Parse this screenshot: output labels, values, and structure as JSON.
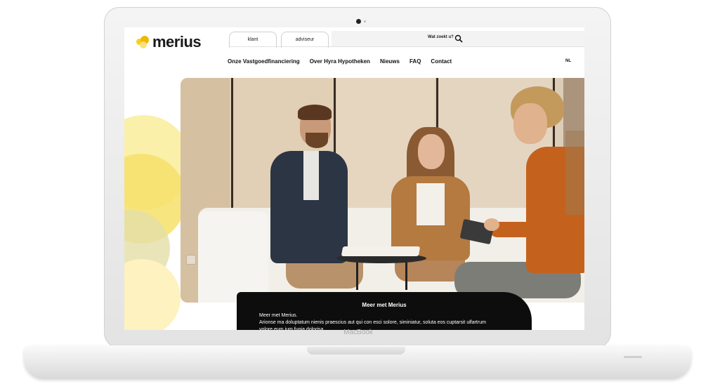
{
  "device": {
    "bottom_label": "MacBook"
  },
  "brand": {
    "name": "merius"
  },
  "tabs": [
    {
      "label": "klant"
    },
    {
      "label": "adviseur"
    }
  ],
  "search": {
    "label": "Wat zoekt u?",
    "icon": "search-icon"
  },
  "nav": {
    "items": [
      {
        "label": "Onze Vastgoedfinanciering"
      },
      {
        "label": "Over Hyra Hypotheken"
      },
      {
        "label": "Nieuws"
      },
      {
        "label": "FAQ"
      },
      {
        "label": "Contact"
      }
    ],
    "language": "NL"
  },
  "hero": {
    "image": "photo of three people in a meeting on a sofa"
  },
  "info_card": {
    "title": "Meer met Merius",
    "subtitle": "Meer met Merius.",
    "body": "Arionse ma doluptatum nienis praescius aut qui con esci solore, siminiatur, soluta eos cuptarsit ulfartrum volore eum ium fugia dolorisa"
  },
  "colors": {
    "accent": "#f7d21e",
    "text": "#111111",
    "card": "#0d0d0d"
  }
}
